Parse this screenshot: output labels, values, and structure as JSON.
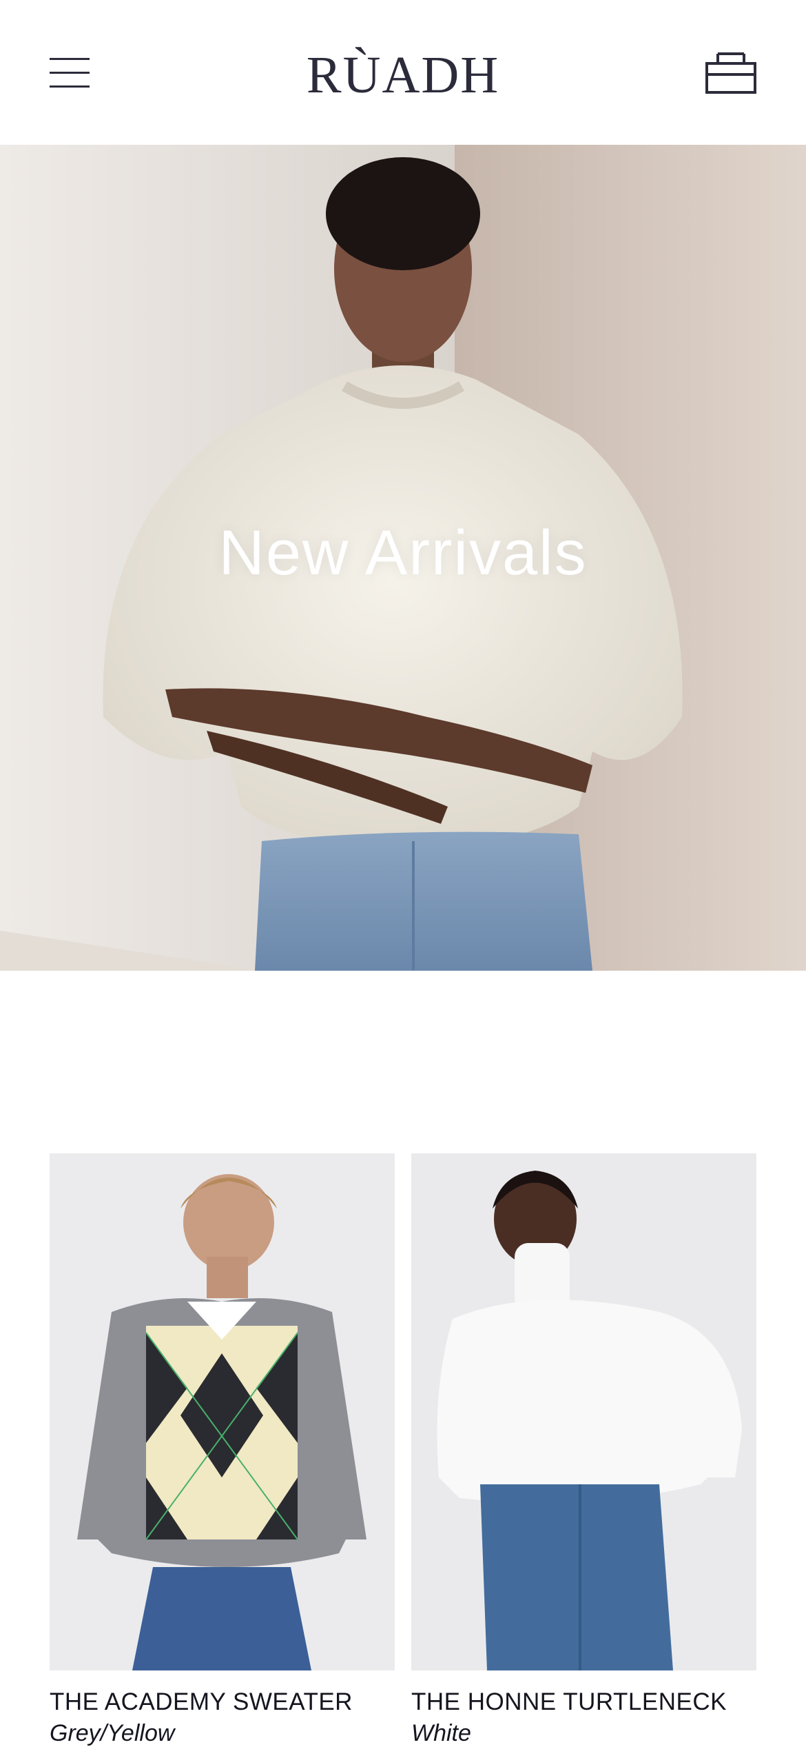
{
  "header": {
    "brand": "RÙADH",
    "menu_icon": "hamburger-menu-icon",
    "cart_icon": "shopping-bag-icon"
  },
  "hero": {
    "title": "New Arrivals"
  },
  "products": [
    {
      "name": "THE ACADEMY SWEATER",
      "variant": "Grey/Yellow"
    },
    {
      "name": "THE HONNE TURTLENECK",
      "variant": "White"
    }
  ],
  "colors": {
    "brand_text": "#2b2b3b",
    "background": "#ffffff",
    "hero_text": "#ffffff"
  }
}
